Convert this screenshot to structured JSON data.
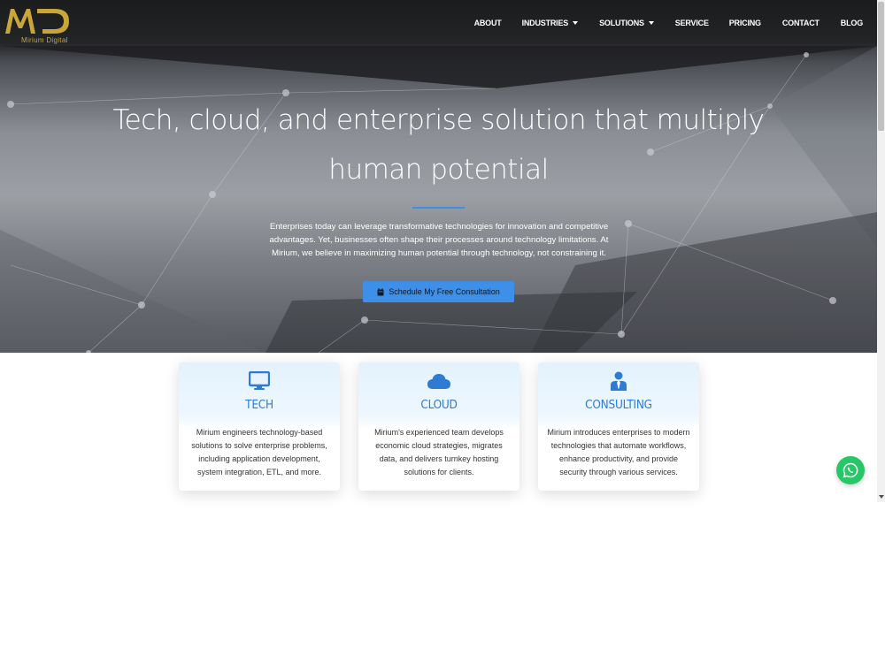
{
  "brand": {
    "logo_text": "MD",
    "tagline": "Mirium Digital",
    "gold": "#c9a63a"
  },
  "nav": [
    {
      "label": "ABOUT",
      "dropdown": false
    },
    {
      "label": "INDUSTRIES",
      "dropdown": true
    },
    {
      "label": "SOLUTIONS",
      "dropdown": true
    },
    {
      "label": "SERVICE",
      "dropdown": false
    },
    {
      "label": "PRICING",
      "dropdown": false
    },
    {
      "label": "CONTACT",
      "dropdown": false
    },
    {
      "label": "BLOG",
      "dropdown": false
    }
  ],
  "hero": {
    "title_line1": "Tech, cloud, and enterprise solution that multiply",
    "title_line2": "human potential",
    "paragraph": "Enterprises today can leverage transformative technologies for innovation and competitive advantages. Yet, businesses often shape their processes around technology limitations. At Mirium, we believe in maximizing human potential through technology, not constraining it.",
    "cta_label": "Schedule My Free Consultation",
    "cta_icon": "calendar-icon",
    "accent": "#3d8fe8"
  },
  "cards": [
    {
      "icon": "monitor-icon",
      "title": "TECH",
      "text": "Mirium engineers technology-based solutions to solve enterprise problems, including application development, system integration, ETL, and more."
    },
    {
      "icon": "cloud-icon",
      "title": "CLOUD",
      "text": "Mirium's experienced team develops economic cloud strategies, migrates data, and delivers turnkey hosting solutions for clients."
    },
    {
      "icon": "user-tie-icon",
      "title": "CONSULTING",
      "text": "Mirium introduces enterprises to modern technologies that automate workflows, enhance productivity, and provide security through various services."
    }
  ],
  "chat": {
    "icon": "whatsapp-icon",
    "color": "#25c767"
  }
}
